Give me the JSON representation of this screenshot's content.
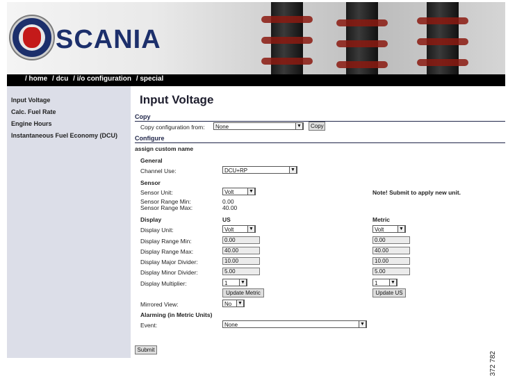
{
  "brand": {
    "name": "SCANIA"
  },
  "breadcrumb": [
    "/ home",
    "/ dcu",
    "/ i/o configuration",
    "/ special"
  ],
  "sidebar": {
    "items": [
      {
        "label": "Input Voltage"
      },
      {
        "label": "Calc. Fuel Rate"
      },
      {
        "label": "Engine Hours"
      },
      {
        "label": "Instantaneous Fuel Economy (DCU)"
      }
    ]
  },
  "page_title": "Input Voltage",
  "copy": {
    "section": "Copy",
    "label": "Copy configuration from:",
    "value": "None",
    "button": "Copy"
  },
  "configure": {
    "section": "Configure",
    "assign_name": "assign custom name",
    "general_header": "General",
    "channel_use_label": "Channel Use:",
    "channel_use_value": "DCU+RP",
    "sensor_header": "Sensor",
    "sensor_unit_label": "Sensor Unit:",
    "sensor_unit_value": "Volt",
    "note": "Note! Submit to apply new unit.",
    "range_min_label": "Sensor Range Min:",
    "range_min_value": "0.00",
    "range_max_label": "Sensor Range Max:",
    "range_max_value": "40.00",
    "display_header": "Display",
    "us_header": "US",
    "metric_header": "Metric",
    "display_rows": [
      {
        "label": "Display Unit:",
        "us": "Volt",
        "metric": "Volt"
      },
      {
        "label": "Display Range Min:",
        "us": "0.00",
        "metric": "0.00"
      },
      {
        "label": "Display Range Max:",
        "us": "40.00",
        "metric": "40.00"
      },
      {
        "label": "Display Major Divider:",
        "us": "10.00",
        "metric": "10.00"
      },
      {
        "label": "Display Minor Divider:",
        "us": "5.00",
        "metric": "5.00"
      },
      {
        "label": "Display Multiplier:",
        "us": "1",
        "metric": "1"
      }
    ],
    "update_metric_button": "Update Metric",
    "update_us_button": "Update US",
    "mirrored_label": "Mirrored View:",
    "mirrored_value": "No",
    "alarming_header": "Alarming (in Metric Units)",
    "event_label": "Event:",
    "event_value": "None"
  },
  "submit_button": "Submit",
  "figure_number": "372 782",
  "icons": {
    "dropdown": "chevron-down-icon",
    "logo": "scania-griffin-logo"
  }
}
